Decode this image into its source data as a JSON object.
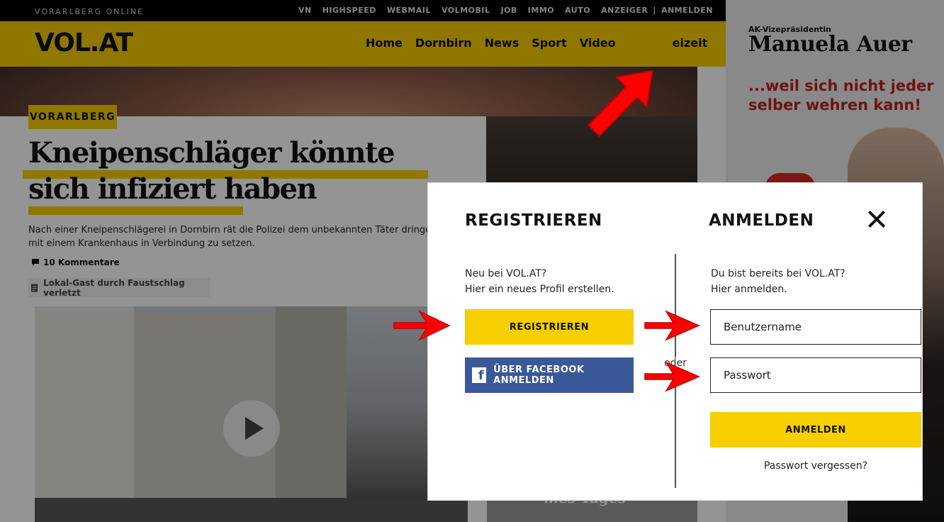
{
  "topbar": {
    "tagline": "VORARLBERG ONLINE",
    "links": [
      "VN",
      "HIGHSPEED",
      "WEBMAIL",
      "VOLMOBIL",
      "JOB",
      "IMMO",
      "AUTO",
      "ANZEIGER",
      "|",
      "ANMELDEN"
    ]
  },
  "header": {
    "logo": "VOL.AT",
    "nav": [
      "Home",
      "Dornbirn",
      "News",
      "Sport",
      "Video"
    ],
    "nav_cut": "eizeit"
  },
  "article": {
    "badge": "VORARLBERG",
    "headline": "Kneipenschläger könnte sich infiziert haben",
    "teaser": "Nach einer Kneipenschlägerei in Dornbirn rät die Polizei dem unbekannten Täter dringend, mit einem Krankenhaus in Verbindung zu setzen.",
    "comments": "10 Kommentare",
    "related": "Lokal-Gast durch Faustschlag verletzt",
    "thumb_caption": "...es Tages"
  },
  "ad": {
    "kicker": "AK-Vizepräsidentin",
    "name": "Manuela Auer",
    "claim": "...weil sich nicht jeder selber wehren kann!"
  },
  "modal": {
    "register_title": "REGISTRIEREN",
    "login_title": "ANMELDEN",
    "register_text_1": "Neu bei VOL.AT?",
    "register_text_2": "Hier ein neues Profil erstellen.",
    "register_button": "REGISTRIEREN",
    "facebook_button": "ÜBER FACEBOOK ANMELDEN",
    "facebook_icon_glyph": "f",
    "or_label": "oder",
    "login_text_1": "Du bist bereits bei VOL.AT?",
    "login_text_2": "Hier anmelden.",
    "username_placeholder": "Benutzername",
    "password_placeholder": "Passwort",
    "login_button": "ANMELDEN",
    "forgot_link": "Passwort vergessen?"
  },
  "colors": {
    "brand_yellow": "#f7ce00",
    "facebook_blue": "#3b5998",
    "annotation_red": "#ff0000"
  }
}
